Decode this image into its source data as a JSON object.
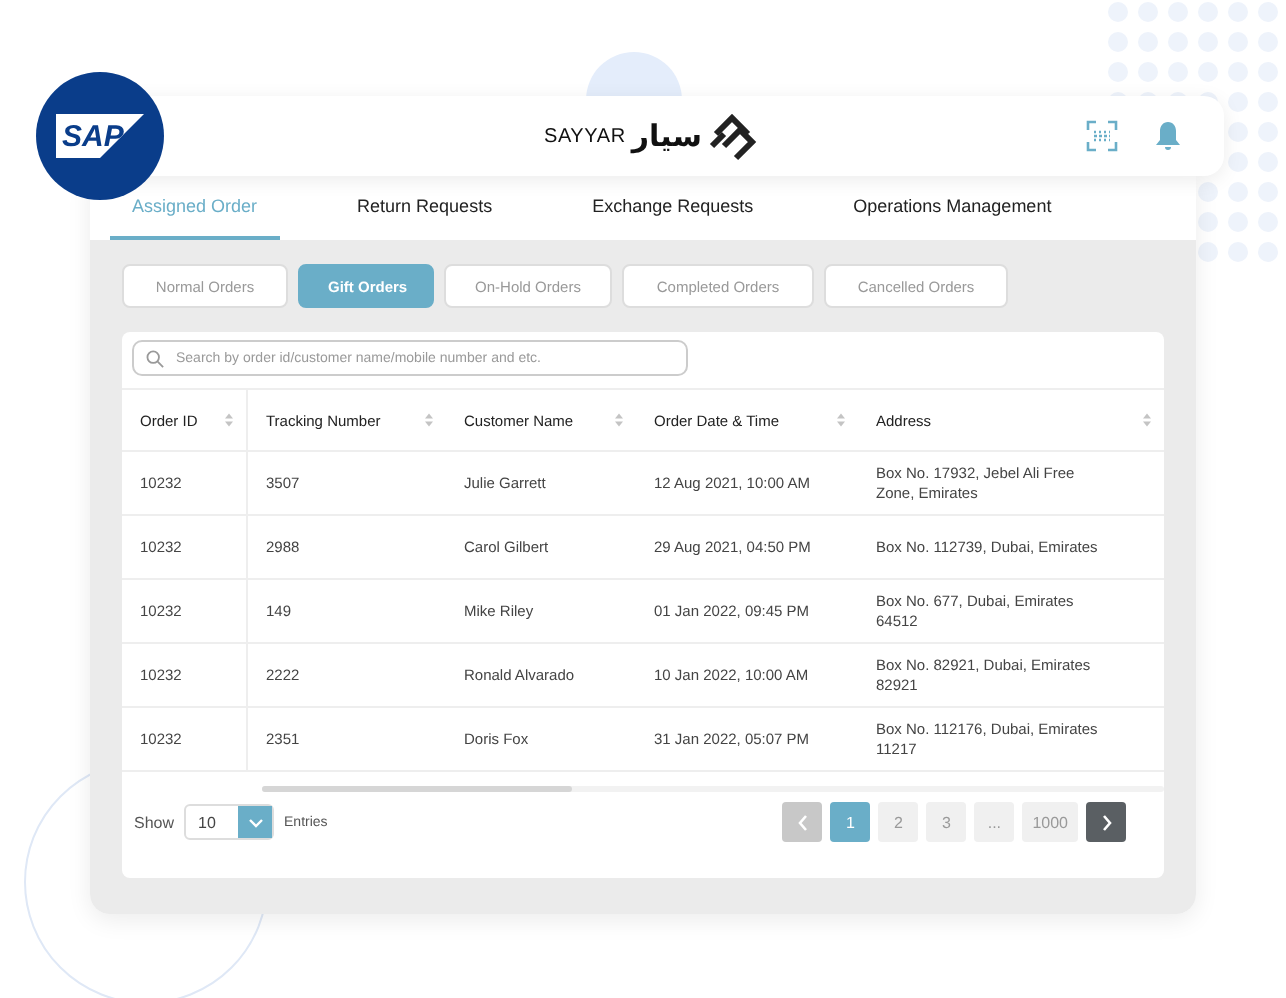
{
  "partner_logo": "SAP",
  "brand": {
    "latin": "SAYYAR",
    "arabic": "سيار"
  },
  "tabs": [
    {
      "label": "Assigned Order",
      "selected": true
    },
    {
      "label": "Return Requests",
      "selected": false
    },
    {
      "label": "Exchange Requests",
      "selected": false
    },
    {
      "label": "Operations Management",
      "selected": false
    }
  ],
  "filters": [
    {
      "label": "Normal Orders",
      "selected": false
    },
    {
      "label": "Gift Orders",
      "selected": true
    },
    {
      "label": "On-Hold Orders",
      "selected": false
    },
    {
      "label": "Completed Orders",
      "selected": false
    },
    {
      "label": "Cancelled Orders",
      "selected": false
    }
  ],
  "search": {
    "placeholder": "Search by order id/customer name/mobile number and etc."
  },
  "table": {
    "columns": [
      "Order ID",
      "Tracking Number",
      "Customer Name",
      "Order Date & Time",
      "Address"
    ],
    "rows": [
      [
        "10232",
        "3507",
        "Julie Garrett",
        "12 Aug 2021, 10:00 AM",
        "Box No. 17932, Jebel Ali Free Zone, Emirates"
      ],
      [
        "10232",
        "2988",
        "Carol Gilbert",
        "29 Aug 2021, 04:50 PM",
        "Box No. 112739, Dubai, Emirates"
      ],
      [
        "10232",
        "149",
        "Mike Riley",
        "01 Jan 2022, 09:45 PM",
        "Box No. 677, Dubai, Emirates 64512"
      ],
      [
        "10232",
        "2222",
        "Ronald Alvarado",
        "10 Jan 2022, 10:00 AM",
        "Box No. 82921, Dubai, Emirates 82921"
      ],
      [
        "10232",
        "2351",
        "Doris Fox",
        "31 Jan 2022, 05:07 PM",
        "Box No. 112176, Dubai, Emirates 11217"
      ]
    ]
  },
  "footer": {
    "show_label": "Show",
    "entries_value": "10",
    "entries_label": "Entries"
  },
  "pagination": [
    {
      "kind": "prev",
      "disabled": true
    },
    {
      "kind": "page",
      "label": "1",
      "selected": true
    },
    {
      "kind": "page",
      "label": "2",
      "selected": false
    },
    {
      "kind": "page",
      "label": "3",
      "selected": false
    },
    {
      "kind": "page",
      "label": "...",
      "selected": false
    },
    {
      "kind": "page",
      "label": "1000",
      "selected": false
    },
    {
      "kind": "next",
      "disabled": false
    }
  ]
}
